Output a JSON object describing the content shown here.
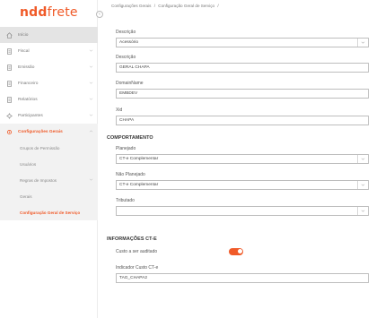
{
  "app": {
    "logo_ndd": "ndd",
    "logo_frete": "frete"
  },
  "sidebar": {
    "items": [
      {
        "label": "Início",
        "icon": "home-icon"
      },
      {
        "label": "Fiscal",
        "icon": "document-icon"
      },
      {
        "label": "Emissão",
        "icon": "document-icon"
      },
      {
        "label": "Financeiro",
        "icon": "document-icon"
      },
      {
        "label": "Relatórios",
        "icon": "document-icon"
      },
      {
        "label": "Participantes",
        "icon": "participants-icon"
      },
      {
        "label": "Configurações Gerais",
        "icon": "gear-icon"
      }
    ],
    "sub_items": [
      {
        "label": "Grupos de Permissão"
      },
      {
        "label": "Usuários"
      },
      {
        "label": "Regras de Impostos"
      },
      {
        "label": "Gerais"
      },
      {
        "label": "Configuração Geral de Serviço"
      }
    ]
  },
  "breadcrumb": {
    "part1": "Configurações Gerais",
    "sep1": "/",
    "part2": "Configuração Geral de Serviço",
    "sep2": "/"
  },
  "form": {
    "descricao_select": {
      "label": "Descrição",
      "value": "Acessório"
    },
    "descricao_input": {
      "label": "Descrição",
      "value": "GERAL CHAPA"
    },
    "domain_name": {
      "label": "DomainName",
      "value": "EMBDEV"
    },
    "xid": {
      "label": "Xid",
      "value": "CHAPA"
    }
  },
  "comportamento": {
    "title": "COMPORTAMENTO",
    "planejado": {
      "label": "Planejado",
      "value": "CT-e Complementar"
    },
    "nao_planejado": {
      "label": "Não Planejado",
      "value": "CT-e Complementar"
    },
    "tributado": {
      "label": "Tributado",
      "value": ""
    }
  },
  "informacoes": {
    "title": "INFORMAÇÕES CT-E",
    "custo_label": "Custo a ser auditado",
    "custo_enabled": true,
    "indicador": {
      "label": "Indicador Custo CT-e",
      "value": "TAG_CHAPA2"
    }
  },
  "colors": {
    "accent": "#f05a28"
  }
}
